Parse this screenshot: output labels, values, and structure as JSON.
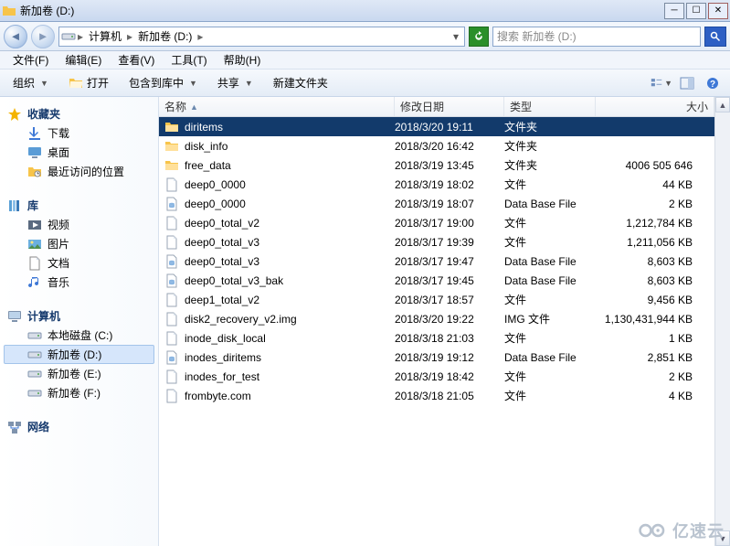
{
  "title": "新加卷 (D:)",
  "address": {
    "seg1": "计算机",
    "seg2": "新加卷 (D:)"
  },
  "search": {
    "placeholder": "搜索 新加卷 (D:)"
  },
  "menu": {
    "file": "文件(F)",
    "edit": "编辑(E)",
    "view": "查看(V)",
    "tools": "工具(T)",
    "help": "帮助(H)"
  },
  "cmd": {
    "organize": "组织",
    "open": "打开",
    "include": "包含到库中",
    "share": "共享",
    "newfolder": "新建文件夹"
  },
  "nav": {
    "favorites": "收藏夹",
    "downloads": "下载",
    "desktop": "桌面",
    "recent": "最近访问的位置",
    "libraries": "库",
    "videos": "视频",
    "pictures": "图片",
    "documents": "文档",
    "music": "音乐",
    "computer": "计算机",
    "localdisk_c": "本地磁盘 (C:)",
    "newvol_d": "新加卷 (D:)",
    "newvol_e": "新加卷 (E:)",
    "newvol_f": "新加卷 (F:)",
    "network": "网络"
  },
  "cols": {
    "name": "名称",
    "date": "修改日期",
    "type": "类型",
    "size": "大小"
  },
  "files": [
    {
      "name": "diritems",
      "date": "2018/3/20 19:11",
      "type": "文件夹",
      "size": "",
      "icon": "folder",
      "sel": true
    },
    {
      "name": "disk_info",
      "date": "2018/3/20 16:42",
      "type": "文件夹",
      "size": "",
      "icon": "folder"
    },
    {
      "name": "free_data",
      "date": "2018/3/19 13:45",
      "type": "文件夹",
      "size": "4006 505 646",
      "icon": "folder"
    },
    {
      "name": "deep0_0000",
      "date": "2018/3/19 18:02",
      "type": "文件",
      "size": "44 KB",
      "icon": "file"
    },
    {
      "name": "deep0_0000",
      "date": "2018/3/19 18:07",
      "type": "Data Base File",
      "size": "2 KB",
      "icon": "db"
    },
    {
      "name": "deep0_total_v2",
      "date": "2018/3/17 19:00",
      "type": "文件",
      "size": "1,212,784 KB",
      "icon": "file"
    },
    {
      "name": "deep0_total_v3",
      "date": "2018/3/17 19:39",
      "type": "文件",
      "size": "1,211,056 KB",
      "icon": "file"
    },
    {
      "name": "deep0_total_v3",
      "date": "2018/3/17 19:47",
      "type": "Data Base File",
      "size": "8,603 KB",
      "icon": "db"
    },
    {
      "name": "deep0_total_v3_bak",
      "date": "2018/3/17 19:45",
      "type": "Data Base File",
      "size": "8,603 KB",
      "icon": "db"
    },
    {
      "name": "deep1_total_v2",
      "date": "2018/3/17 18:57",
      "type": "文件",
      "size": "9,456 KB",
      "icon": "file"
    },
    {
      "name": "disk2_recovery_v2.img",
      "date": "2018/3/20 19:22",
      "type": "IMG 文件",
      "size": "1,130,431,944 KB",
      "icon": "file"
    },
    {
      "name": "inode_disk_local",
      "date": "2018/3/18 21:03",
      "type": "文件",
      "size": "1 KB",
      "icon": "file"
    },
    {
      "name": "inodes_diritems",
      "date": "2018/3/19 19:12",
      "type": "Data Base File",
      "size": "2,851 KB",
      "icon": "db"
    },
    {
      "name": "inodes_for_test",
      "date": "2018/3/19 18:42",
      "type": "文件",
      "size": "2 KB",
      "icon": "file"
    },
    {
      "name": "frombyte.com",
      "date": "2018/3/18 21:05",
      "type": "文件",
      "size": "4 KB",
      "icon": "file"
    }
  ],
  "watermark": "亿速云"
}
